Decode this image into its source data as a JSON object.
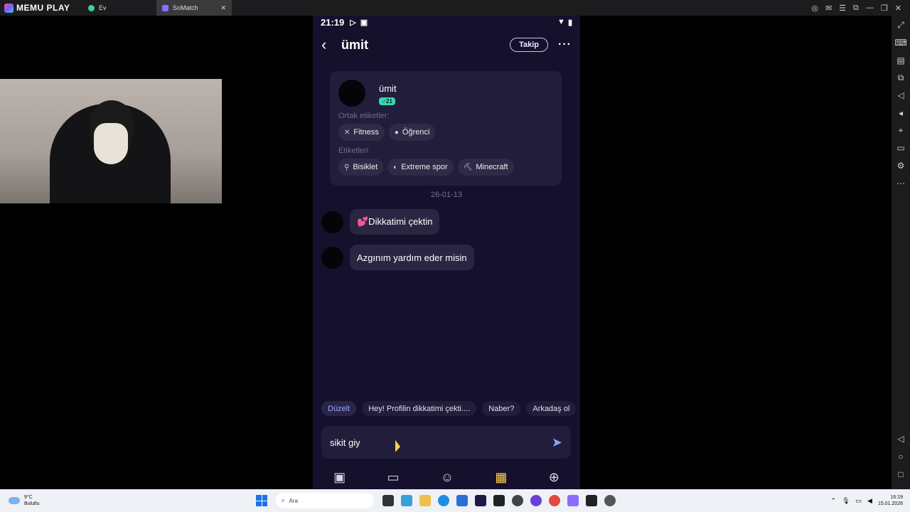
{
  "emulator": {
    "brand": "MEMU PLAY",
    "tabs": [
      {
        "label": "Ev"
      },
      {
        "label": "SoMatch",
        "close": "✕"
      }
    ]
  },
  "status_bar": {
    "time": "21:19"
  },
  "header": {
    "title": "ümit",
    "follow_label": "Takip"
  },
  "profile_card": {
    "name": "ümit",
    "age_badge": "♂21",
    "common_tags_label": "Ortak etiketler:",
    "common_tags": [
      "Fitness",
      "Öğrenci"
    ],
    "tags_label": "Etiketleri",
    "tags": [
      "Bisiklet",
      "Extreme spor",
      "Minecraft"
    ]
  },
  "chat": {
    "date": "26-01-13",
    "messages": [
      "💕Dikkatimi çektin",
      "Azgınım yardım eder misin"
    ]
  },
  "suggestions": {
    "edit_label": "Düzelt",
    "chips": [
      "Hey! Profilin dikkatimi çekti....",
      "Naber?",
      "Arkadaş ol"
    ]
  },
  "composer": {
    "value": "sikit giy"
  },
  "taskbar": {
    "temperature": "9°C",
    "condition": "Bulutlu",
    "search_placeholder": "Ara",
    "time": "16:19",
    "date": "15.01.2026"
  }
}
